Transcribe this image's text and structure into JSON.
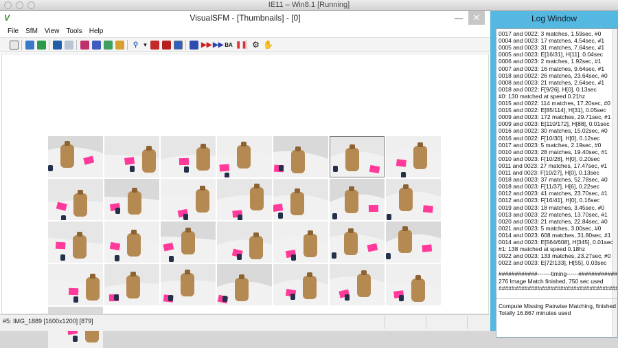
{
  "mac_window": {
    "title": "IE11 – Win8.1 [Running]"
  },
  "app": {
    "title": "VisualSFM - [Thumbnails] - [0]",
    "menus": [
      "File",
      "SfM",
      "View",
      "Tools",
      "Help"
    ],
    "toolbar_text": {
      "ba": "BA"
    },
    "window_buttons": {
      "minimize": "—",
      "close": "✕"
    }
  },
  "status": {
    "text": "#5: IMG_1889 [1600x1200] [879]"
  },
  "thumbnails": {
    "count": 29,
    "selected_index": 5,
    "colors": {
      "background": "#f1f1f1",
      "pink": "#ff3a9a",
      "wood": "#b58a52",
      "dark": "#22304a"
    }
  },
  "log": {
    "title": "Log Window",
    "lines_top": [
      "0017 and 0022: 3 matches, 1.59sec, #0",
      "0004 and 0023: 17 matches, 4.54sec, #1",
      "0005 and 0023: 31 matches, 7.64sec, #1",
      "0005 and 0023: E[16/31], H[11], 0.04sec",
      "0006 and 0023: 2 matches, 1.92sec, #1",
      "0007 and 0023: 16 matches, 9.64sec, #1",
      "0018 and 0022: 26 matches, 23.64sec, #0",
      "0008 and 0023: 21 matches, 2.64sec, #1",
      "0018 and 0022: F[9/26], H[0], 0.13sec",
      "#0: 130 matched at speed 0.21hz",
      "0015 and 0022: 114 matches, 17.20sec, #0",
      "0015 and 0022: E[85/114], H[31], 0.05sec",
      "0009 and 0023: 172 matches, 29.71sec, #1",
      "0009 and 0023: E[110/172], H[88], 0.01sec",
      "0016 and 0022: 30 matches, 15.02sec, #0",
      "0016 and 0022: F[10/30], H[0], 0.12sec",
      "0017 and 0023: 5 matches, 2.19sec, #0",
      "0010 and 0023: 28 matches, 19.40sec, #1",
      "0010 and 0023: F[10/28], H[0], 0.20sec",
      "0011 and 0023: 27 matches, 17.47sec, #1",
      "0011 and 0023: F[10/27], H[0], 0.13sec",
      "0018 and 0023: 37 matches, 52.78sec, #0",
      "0018 and 0023: F[11/37], H[6], 0.22sec",
      "0012 and 0023: 41 matches, 23.70sec, #1",
      "0012 and 0023: F[16/41], H[0], 0.16sec",
      "0019 and 0023: 18 matches, 3.45sec, #0",
      "0013 and 0023: 22 matches, 13.70sec, #1",
      "0020 and 0023: 21 matches, 22.84sec, #0",
      "0021 and 0023: 5 matches, 3.00sec, #0",
      "0014 and 0023: 608 matches, 31.80sec, #1",
      "0014 and 0023: E[564/608], H[345], 0.01sec",
      "#1: 138 matched at speed 0.18hz",
      "0022 and 0023: 133 matches, 23.27sec, #0",
      "0022 and 0023: E[72/133], H[55], 0.03sec"
    ],
    "lines_mid": [
      "############-------timing------############",
      "276 Image Match finished, 750 sec used",
      "#########################################"
    ],
    "lines_bottom": [
      "Compute Missing Pairwise Matching, finished",
      "Totally 16.867 minutes used"
    ]
  }
}
